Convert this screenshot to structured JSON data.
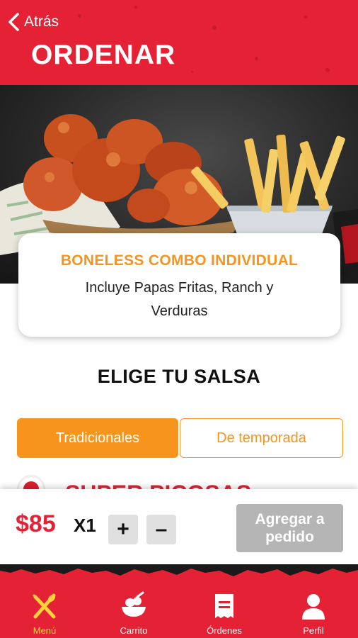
{
  "header": {
    "back_label": "Atrás",
    "title": "ORDENAR"
  },
  "product": {
    "name": "BONELESS COMBO INDIVIDUAL",
    "description": "Incluye Papas Fritas, Ranch y Verduras"
  },
  "section_title": "ELIGE TU SALSA",
  "tabs": [
    {
      "label": "Tradicionales",
      "active": true
    },
    {
      "label": "De temporada",
      "active": false
    }
  ],
  "sauce_peek": {
    "label": "SUPER PICOSAS"
  },
  "order": {
    "price": "$85",
    "quantity": "X1",
    "plus_label": "+",
    "minus_label": "–",
    "add_button": "Agregar a pedido"
  },
  "nav": [
    {
      "label": "Menú",
      "icon": "utensils-icon",
      "active": true
    },
    {
      "label": "Carrito",
      "icon": "cart-icon",
      "active": false
    },
    {
      "label": "Órdenes",
      "icon": "receipt-icon",
      "active": false
    },
    {
      "label": "Perfil",
      "icon": "user-icon",
      "active": false
    }
  ],
  "colors": {
    "brand_red": "#e52235",
    "accent_orange": "#f7941d",
    "active_nav": "#ffd23c",
    "disabled_button": "#b5b5b5"
  }
}
